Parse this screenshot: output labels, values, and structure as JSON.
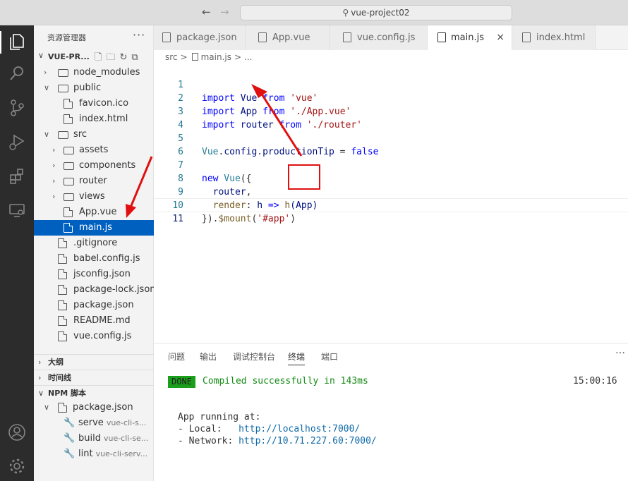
{
  "titlebar": {
    "back_icon": "arrow-left",
    "forward_icon": "arrow-right",
    "search_text": "vue-project02"
  },
  "activitybar": {
    "items": [
      "files-icon",
      "search-icon",
      "source-control-icon",
      "run-debug-icon",
      "extensions-icon",
      "remote-explorer-icon"
    ],
    "bottom": [
      "account-icon",
      "settings-gear-icon"
    ]
  },
  "sidebar": {
    "title": "资源管理器",
    "project": "VUE-PR...",
    "tree": [
      {
        "label": "node_modules",
        "type": "folder",
        "open": false
      },
      {
        "label": "public",
        "type": "folder",
        "open": true
      },
      {
        "label": "favicon.ico",
        "type": "file"
      },
      {
        "label": "index.html",
        "type": "file"
      },
      {
        "label": "src",
        "type": "folder",
        "open": true
      },
      {
        "label": "assets",
        "type": "folder",
        "open": false
      },
      {
        "label": "components",
        "type": "folder",
        "open": false
      },
      {
        "label": "router",
        "type": "folder",
        "open": false
      },
      {
        "label": "views",
        "type": "folder",
        "open": false
      },
      {
        "label": "App.vue",
        "type": "file"
      },
      {
        "label": "main.js",
        "type": "file",
        "selected": true
      },
      {
        "label": ".gitignore",
        "type": "file"
      },
      {
        "label": "babel.config.js",
        "type": "file"
      },
      {
        "label": "jsconfig.json",
        "type": "file"
      },
      {
        "label": "package-lock.json",
        "type": "file"
      },
      {
        "label": "package.json",
        "type": "file"
      },
      {
        "label": "README.md",
        "type": "file"
      },
      {
        "label": "vue.config.js",
        "type": "file"
      }
    ],
    "sections": {
      "outline": "大纲",
      "timeline": "时间线",
      "npm": "NPM 脚本"
    },
    "npm": {
      "file": "package.json",
      "scripts": [
        {
          "name": "serve",
          "cmd": "vue-cli-s..."
        },
        {
          "name": "build",
          "cmd": "vue-cli-se..."
        },
        {
          "name": "lint",
          "cmd": "vue-cli-serv..."
        }
      ]
    }
  },
  "tabs": [
    {
      "label": "package.json"
    },
    {
      "label": "App.vue"
    },
    {
      "label": "vue.config.js"
    },
    {
      "label": "main.js",
      "active": true,
      "close": "×"
    },
    {
      "label": "index.html"
    }
  ],
  "breadcrumb": {
    "root": "src",
    "sep": ">",
    "file": "main.js",
    "more": "..."
  },
  "code": {
    "line_numbers": [
      "1",
      "2",
      "3",
      "4",
      "5",
      "6",
      "7",
      "8",
      "9",
      "10",
      "11"
    ],
    "l1": {
      "kw1": "import",
      "id": " Vue ",
      "kw2": "from",
      "str": " 'vue'"
    },
    "l2": {
      "kw1": "import",
      "id": " App ",
      "kw2": "from",
      "str": " './App.vue'"
    },
    "l3": {
      "kw1": "import",
      "id": " router ",
      "kw2": "from",
      "str": " './router'"
    },
    "l5": {
      "a": "Vue",
      "b": ".",
      "c": "config",
      "d": ".",
      "e": "productionTip",
      "f": " = ",
      "g": "false"
    },
    "l7": {
      "kw": "new",
      "ty": " Vue",
      "rest": "({"
    },
    "l8": {
      "id": "  router",
      "rest": ","
    },
    "l9": {
      "id": "  render",
      "op": ": ",
      "p": "h",
      "arrow": " => ",
      "fn": "h",
      "arg": "(App)"
    },
    "l10": {
      "a": "}).",
      "fn": "$mount",
      "b": "(",
      "str": "'#app'",
      "c": ")"
    }
  },
  "panel": {
    "tabs": [
      "问题",
      "输出",
      "调试控制台",
      "终端",
      "端口"
    ],
    "active_tab": "终端",
    "done": "DONE",
    "compiled": "Compiled successfully in 143ms",
    "time": "15:00:16",
    "running": "App running at:",
    "local_label": "- Local:   ",
    "local_url": "http://localhost:7000/",
    "network_label": "- Network: ",
    "network_url": "http://10.71.227.60:7000/"
  },
  "colors": {
    "accent": "#0060c0",
    "annotation": "#e01010",
    "done_green": "#1a9f1a"
  }
}
